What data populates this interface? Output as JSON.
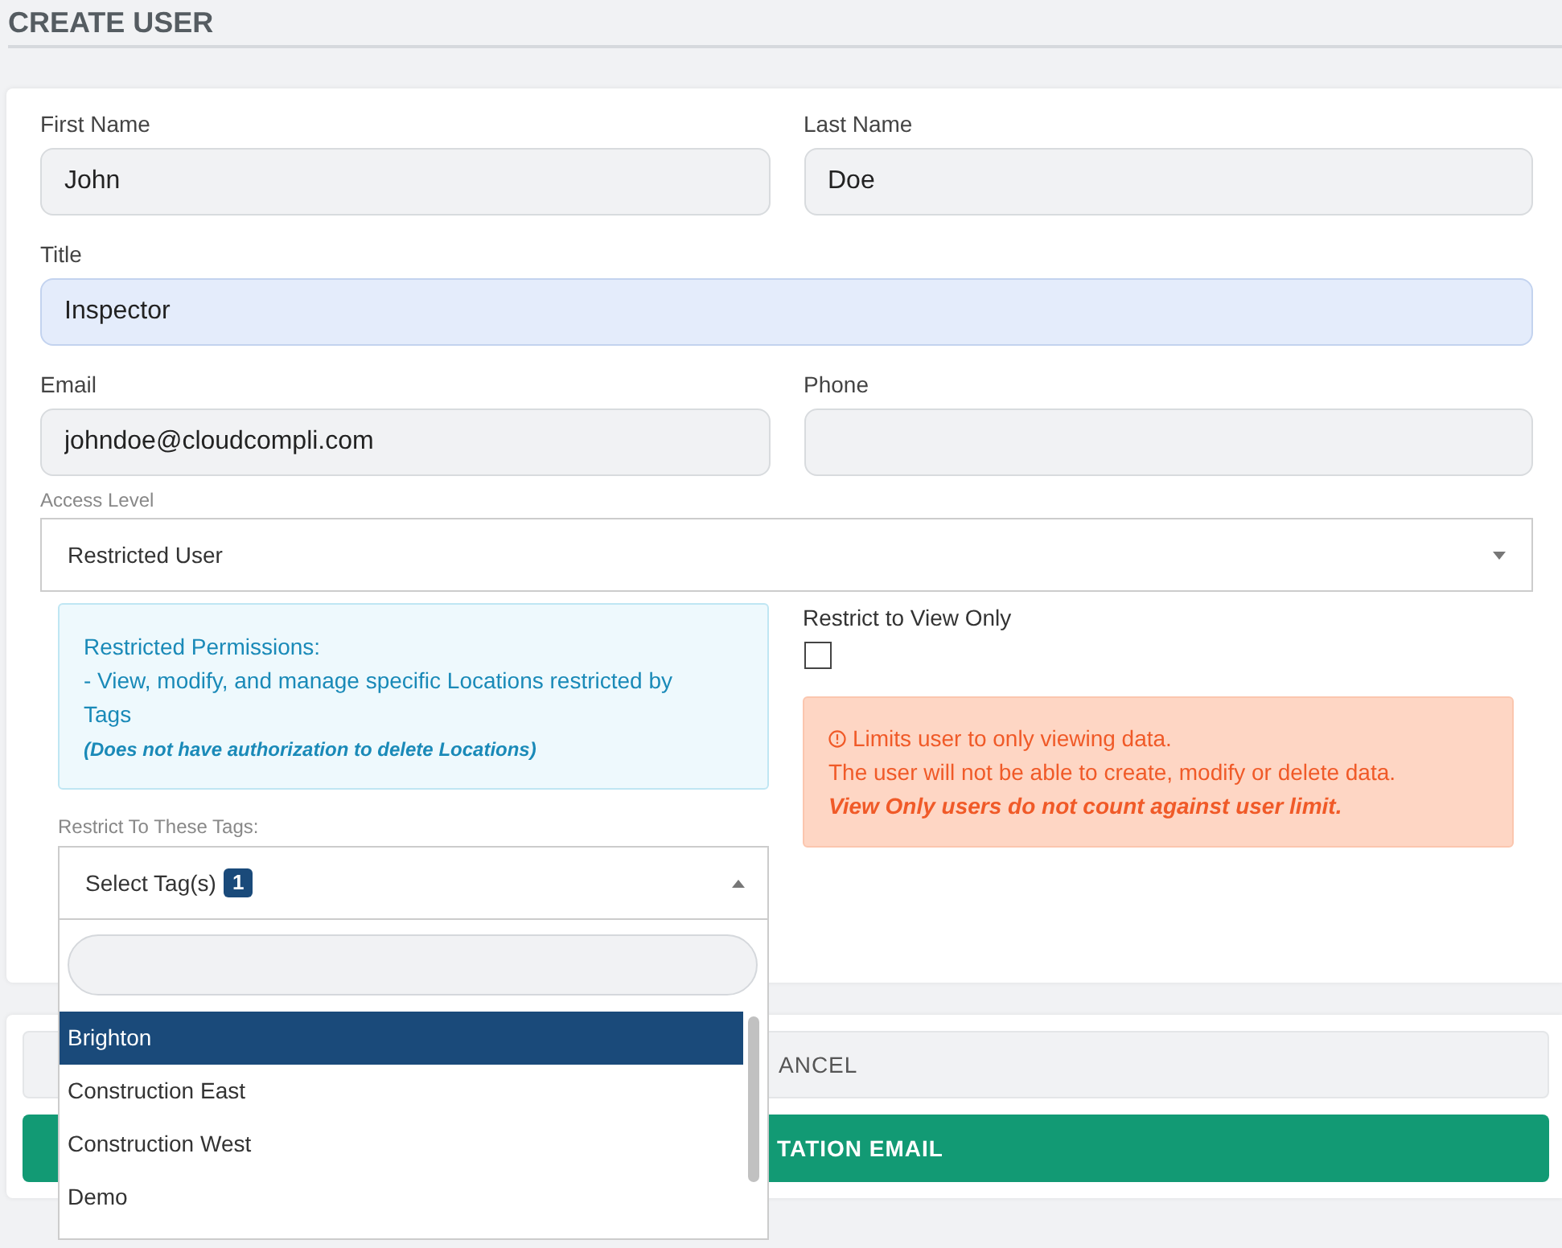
{
  "page": {
    "title": "CREATE USER"
  },
  "field_rows": [
    [
      {
        "label": "First Name",
        "value": "John",
        "autofilled": false
      },
      {
        "label": "Last Name",
        "value": "Doe",
        "autofilled": false
      }
    ],
    [
      {
        "label": "Title",
        "value": "Inspector",
        "autofilled": true
      }
    ],
    [
      {
        "label": "Email",
        "value": "johndoe@cloudcompli.com",
        "autofilled": false
      },
      {
        "label": "Phone",
        "autofilled": false
      }
    ]
  ],
  "access_level": {
    "label": "Access Level",
    "value": "Restricted User"
  },
  "permissions_note": {
    "heading": "Restricted Permissions:",
    "line": "- View, modify, and manage specific Locations restricted by Tags",
    "note": "(Does not have authorization to delete Locations)"
  },
  "view_only": {
    "label": "Restrict to View Only",
    "checked": false
  },
  "view_only_alert": {
    "lines": [
      "Limits user to only viewing data.",
      "The user will not be able to create, modify or delete data."
    ],
    "emphasis": "View Only users do not count against user limit."
  },
  "tags": {
    "label": "Restrict To These Tags:",
    "text": "Select Tag(s)",
    "count": "1",
    "expanded": true,
    "options": [
      {
        "label": "Brighton",
        "selected": true
      },
      {
        "label": "Construction East",
        "selected": false
      },
      {
        "label": "Construction West",
        "selected": false
      },
      {
        "label": "Demo",
        "selected": false
      }
    ]
  },
  "buttons": [
    {
      "kind": "secondary",
      "label": "ANCEL"
    },
    {
      "kind": "primary",
      "label": "TATION EMAIL"
    }
  ]
}
